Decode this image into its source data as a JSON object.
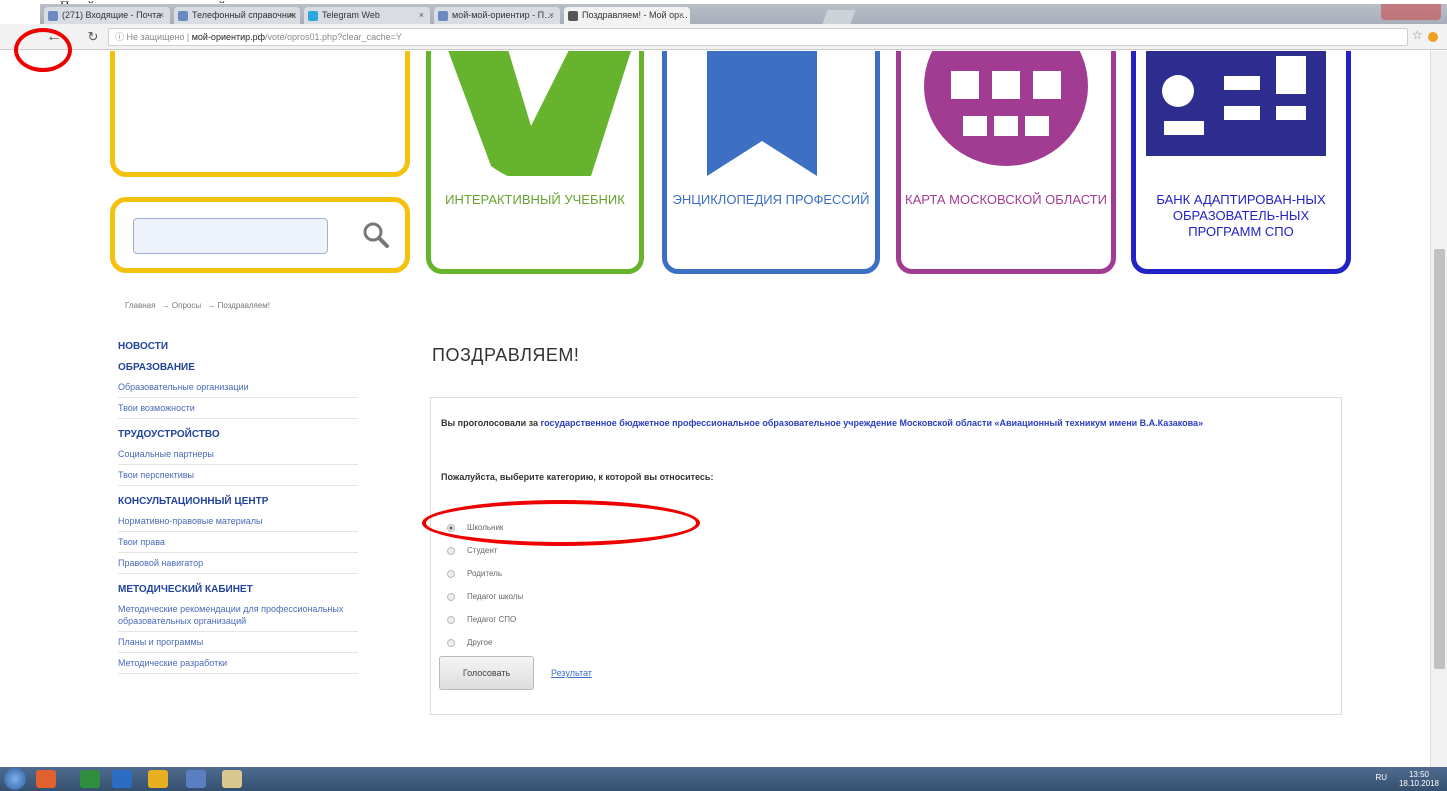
{
  "caption": "Перейти в приложение, перейти …",
  "browser": {
    "tabs": [
      {
        "label": "(271) Входящие - Почта"
      },
      {
        "label": "Телефонный справочник"
      },
      {
        "label": "Telegram Web"
      },
      {
        "label": "мой-мой-ориентир - П…"
      },
      {
        "label": "Поздравляем! - Мой ор…"
      }
    ],
    "address": {
      "security": "Не защищено",
      "host": "мой-ориентир.рф",
      "path": "/vote/opros01.php?clear_cache=Y"
    }
  },
  "tiles": {
    "textbook": "ИНТЕРАКТИВНЫЙ УЧЕБНИК",
    "encyclopedia": "ЭНЦИКЛОПЕДИЯ ПРОФЕССИЙ",
    "map": "КАРТА МОСКОВСКОЙ ОБЛАСТИ",
    "bank": "БАНК АДАПТИРОВАН-НЫХ ОБРАЗОВАТЕЛЬ-НЫХ ПРОГРАММ СПО"
  },
  "breadcrumb": [
    "Главная",
    "→ Опросы",
    "→ Поздравляем!"
  ],
  "sidebar": {
    "sections": [
      {
        "title": "НОВОСТИ",
        "items": []
      },
      {
        "title": "ОБРАЗОВАНИЕ",
        "items": [
          "Образовательные организации",
          "Твои возможности"
        ]
      },
      {
        "title": "ТРУДОУСТРОЙСТВО",
        "items": [
          "Социальные партнеры",
          "Твои перспективы"
        ]
      },
      {
        "title": "КОНСУЛЬТАЦИОННЫЙ ЦЕНТР",
        "items": [
          "Нормативно-правовые материалы",
          "Твои права",
          "Правовой навигатор"
        ]
      },
      {
        "title": "МЕТОДИЧЕСКИЙ КАБИНЕТ",
        "items": [
          "Методические рекомендации для профессиональных образовательных организаций",
          "Планы и программы",
          "Методические разработки"
        ]
      }
    ]
  },
  "main": {
    "heading": "ПОЗДРАВЛЯЕМ!",
    "voted_prefix": "Вы проголосовали за",
    "voted_org": "государственное бюджетное профессиональное образовательное учреждение Московской области «Авиационный техникум имени В.А.Казакова»",
    "question": "Пожалуйста, выберите категорию, к которой вы относитесь:",
    "options": [
      "Школьник",
      "Студент",
      "Родитель",
      "Педагог школы",
      "Педагог СПО",
      "Другое"
    ],
    "selected_index": 0,
    "vote_button": "Голосовать",
    "result_link": "Результат"
  },
  "taskbar": {
    "tray": "RU",
    "time": "13:50",
    "date": "18.10.2018"
  },
  "colors": {
    "yellow": "#f4c20d",
    "green": "#66b32e",
    "blue": "#3d6fc3",
    "purple": "#a23c93",
    "navy": "#2222c8",
    "annotation": "#e00000"
  }
}
